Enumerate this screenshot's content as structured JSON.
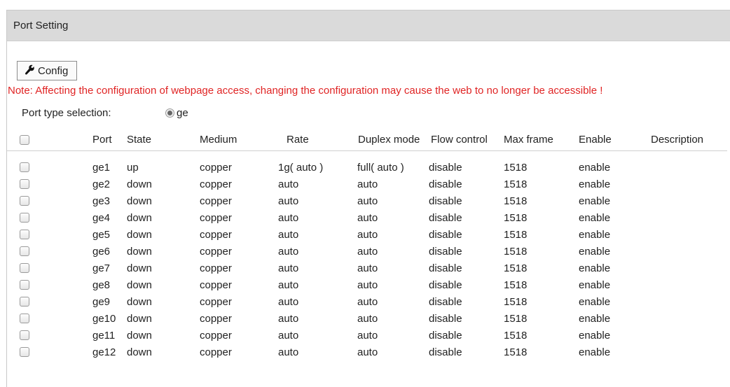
{
  "panel": {
    "title": "Port Setting"
  },
  "config_button": {
    "label": "Config",
    "icon": "wrench-icon"
  },
  "note": "Note: Affecting the configuration of webpage access, changing the configuration may cause the web to no longer be accessible !",
  "port_type": {
    "label": "Port type selection:",
    "selected_option": "ge"
  },
  "colors": {
    "note": "#e02424",
    "header_bg": "#dadada"
  },
  "table": {
    "headers": [
      "Port",
      "State",
      "Medium",
      "Rate",
      "Duplex mode",
      "Flow control",
      "Max frame",
      "Enable",
      "Description"
    ],
    "rows": [
      {
        "port": "ge1",
        "state": "up",
        "medium": "copper",
        "rate": "1g( auto )",
        "duplex": "full( auto )",
        "flow": "disable",
        "max_frame": "1518",
        "enable": "enable",
        "description": ""
      },
      {
        "port": "ge2",
        "state": "down",
        "medium": "copper",
        "rate": "auto",
        "duplex": "auto",
        "flow": "disable",
        "max_frame": "1518",
        "enable": "enable",
        "description": ""
      },
      {
        "port": "ge3",
        "state": "down",
        "medium": "copper",
        "rate": "auto",
        "duplex": "auto",
        "flow": "disable",
        "max_frame": "1518",
        "enable": "enable",
        "description": ""
      },
      {
        "port": "ge4",
        "state": "down",
        "medium": "copper",
        "rate": "auto",
        "duplex": "auto",
        "flow": "disable",
        "max_frame": "1518",
        "enable": "enable",
        "description": ""
      },
      {
        "port": "ge5",
        "state": "down",
        "medium": "copper",
        "rate": "auto",
        "duplex": "auto",
        "flow": "disable",
        "max_frame": "1518",
        "enable": "enable",
        "description": ""
      },
      {
        "port": "ge6",
        "state": "down",
        "medium": "copper",
        "rate": "auto",
        "duplex": "auto",
        "flow": "disable",
        "max_frame": "1518",
        "enable": "enable",
        "description": ""
      },
      {
        "port": "ge7",
        "state": "down",
        "medium": "copper",
        "rate": "auto",
        "duplex": "auto",
        "flow": "disable",
        "max_frame": "1518",
        "enable": "enable",
        "description": ""
      },
      {
        "port": "ge8",
        "state": "down",
        "medium": "copper",
        "rate": "auto",
        "duplex": "auto",
        "flow": "disable",
        "max_frame": "1518",
        "enable": "enable",
        "description": ""
      },
      {
        "port": "ge9",
        "state": "down",
        "medium": "copper",
        "rate": "auto",
        "duplex": "auto",
        "flow": "disable",
        "max_frame": "1518",
        "enable": "enable",
        "description": ""
      },
      {
        "port": "ge10",
        "state": "down",
        "medium": "copper",
        "rate": "auto",
        "duplex": "auto",
        "flow": "disable",
        "max_frame": "1518",
        "enable": "enable",
        "description": ""
      },
      {
        "port": "ge11",
        "state": "down",
        "medium": "copper",
        "rate": "auto",
        "duplex": "auto",
        "flow": "disable",
        "max_frame": "1518",
        "enable": "enable",
        "description": ""
      },
      {
        "port": "ge12",
        "state": "down",
        "medium": "copper",
        "rate": "auto",
        "duplex": "auto",
        "flow": "disable",
        "max_frame": "1518",
        "enable": "enable",
        "description": ""
      }
    ]
  }
}
